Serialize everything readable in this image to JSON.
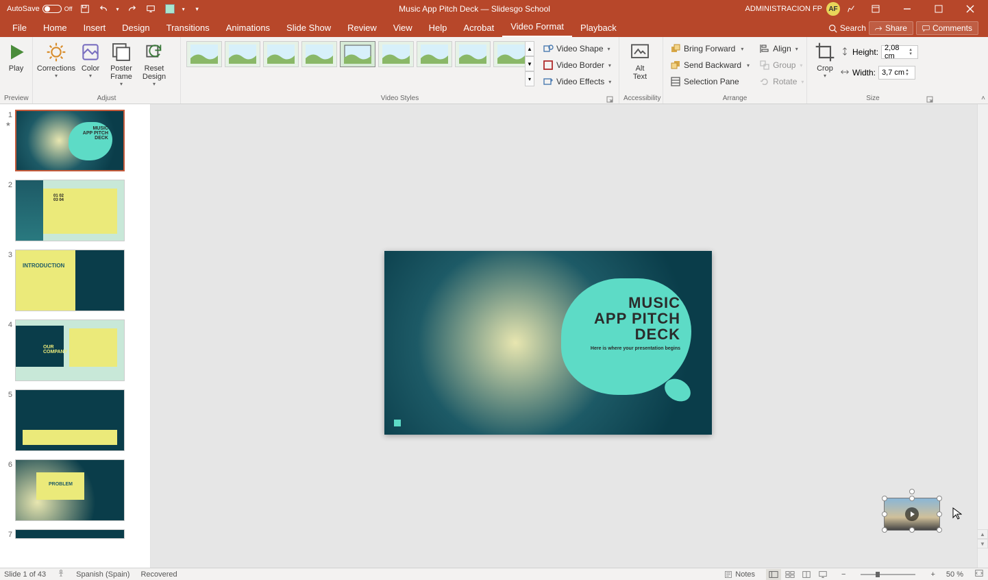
{
  "titlebar": {
    "autosave_label": "AutoSave",
    "autosave_state": "Off",
    "doc_title": "Music App Pitch Deck — Slidesgo School",
    "account": "ADMINISTRACION FP",
    "avatar": "AF"
  },
  "menubar": {
    "tabs": [
      "File",
      "Home",
      "Insert",
      "Design",
      "Transitions",
      "Animations",
      "Slide Show",
      "Review",
      "View",
      "Help",
      "Acrobat",
      "Video Format",
      "Playback"
    ],
    "active": "Video Format",
    "search_placeholder": "Search",
    "share": "Share",
    "comments": "Comments"
  },
  "ribbon": {
    "preview": {
      "play": "Play",
      "group_label": "Preview"
    },
    "adjust": {
      "corrections": "Corrections",
      "color": "Color",
      "poster_frame": "Poster\nFrame",
      "reset_design": "Reset\nDesign",
      "group_label": "Adjust"
    },
    "video_styles": {
      "video_shape": "Video Shape",
      "video_border": "Video Border",
      "video_effects": "Video Effects",
      "group_label": "Video Styles"
    },
    "accessibility": {
      "alt_text": "Alt\nText",
      "group_label": "Accessibility"
    },
    "arrange": {
      "bring_forward": "Bring Forward",
      "send_backward": "Send Backward",
      "selection_pane": "Selection Pane",
      "align": "Align",
      "group": "Group",
      "rotate": "Rotate",
      "group_label": "Arrange"
    },
    "size": {
      "crop": "Crop",
      "height_label": "Height:",
      "height_value": "2,08 cm",
      "width_label": "Width:",
      "width_value": "3,7 cm",
      "group_label": "Size"
    }
  },
  "slides": [
    {
      "num": "1",
      "current": true,
      "star": true
    },
    {
      "num": "2"
    },
    {
      "num": "3"
    },
    {
      "num": "4"
    },
    {
      "num": "5"
    },
    {
      "num": "6"
    },
    {
      "num": "7"
    }
  ],
  "canvas_slide": {
    "title_line1": "MUSIC",
    "title_line2": "APP PITCH",
    "title_line3": "DECK",
    "subtitle": "Here is where your presentation begins"
  },
  "statusbar": {
    "slide_info": "Slide 1 of 43",
    "language": "Spanish (Spain)",
    "recovered": "Recovered",
    "notes": "Notes",
    "zoom": "50 %"
  }
}
